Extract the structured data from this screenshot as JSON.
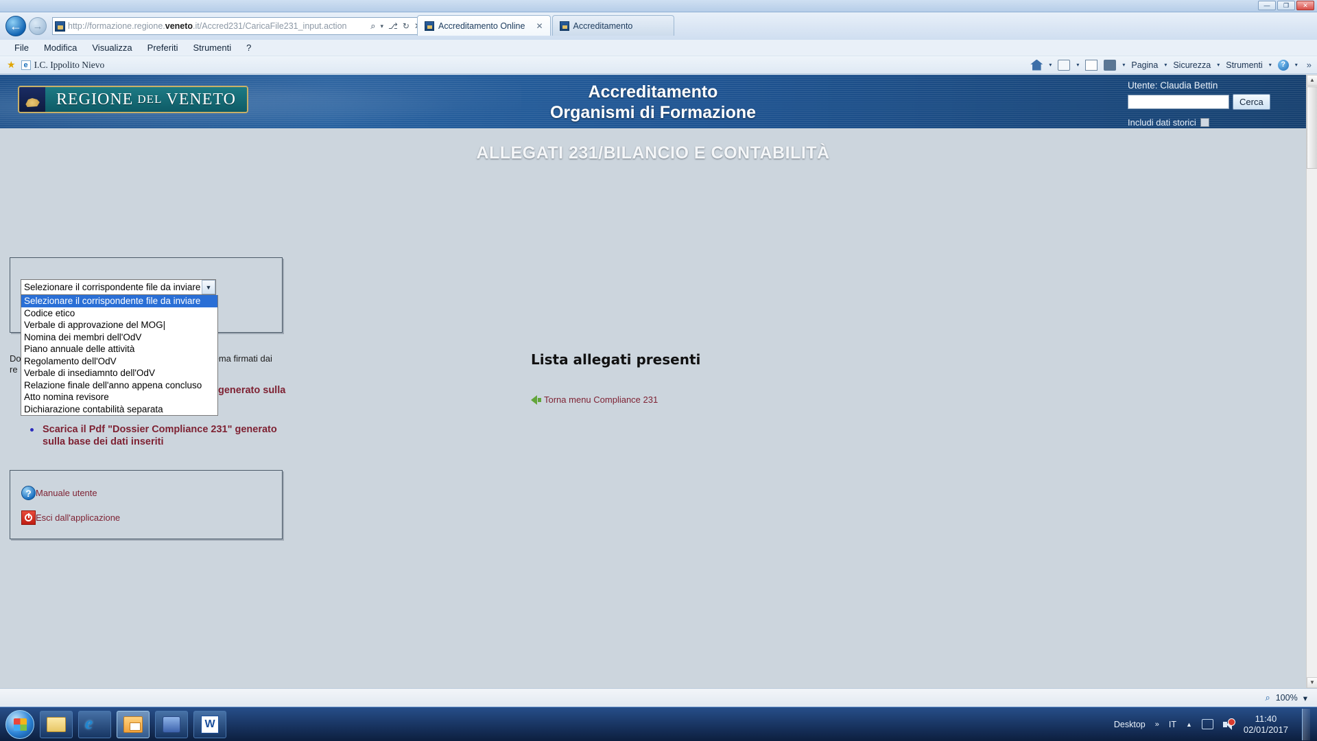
{
  "browser": {
    "address_url_prefix": "http://formazione.regione.",
    "address_url_bold": "veneto",
    "address_url_suffix": ".it/Accred231/CaricaFile231_input.action",
    "tabs": [
      {
        "label": "Accreditamento Online",
        "active": true,
        "close": "✕"
      },
      {
        "label": "Accreditamento",
        "active": false,
        "close": ""
      }
    ],
    "menu": [
      "File",
      "Modifica",
      "Visualizza",
      "Preferiti",
      "Strumenti",
      "?"
    ],
    "favorites": {
      "item": "I.C. Ippolito Nievo"
    },
    "command_bar": [
      "Pagina",
      "Sicurezza",
      "Strumenti"
    ],
    "command_overflow": "»",
    "window_buttons": {
      "minimize": "—",
      "maximize": "❐",
      "close": "✕"
    },
    "nav_back": "←",
    "nav_forward": "→",
    "addr_icons": {
      "search": "⌕",
      "compat": "⎇",
      "refresh": "↻",
      "stop": "✕",
      "caret": "▾"
    }
  },
  "banner": {
    "logo_first": "REGIONE",
    "logo_small": "DEL",
    "logo_last": "VENETO",
    "title_line1": "Accreditamento",
    "title_line2": "Organismi di Formazione",
    "user_label": "Utente: Claudia Bettin",
    "search_value": "",
    "search_placeholder": "",
    "search_button": "Cerca",
    "history_label": "Includi dati storici"
  },
  "page": {
    "title": "ALLEGATI 231/BILANCIO E CONTABILITÀ"
  },
  "upload_panel": {
    "select_value": "Selezionare il corrispondente file da inviare",
    "options": [
      "Selezionare il corrispondente file da inviare",
      "Codice etico",
      "Verbale di approvazione del MOG|",
      "Nomina dei membri dell'OdV",
      "Piano annuale delle attività",
      "Regolamento dell'OdV",
      "Verbale di insediamnto dell'OdV",
      "Relazione finale dell'anno appena concluso",
      "Atto nomina revisore",
      "Dichiarazione contabilità separata"
    ],
    "selected_index": 0,
    "dropdown_arrow": "▼"
  },
  "notes": {
    "frag_left_line1": "Do",
    "frag_left_line2": "re",
    "frag_right_line1": "tema firmati dai",
    "bullet_items": [
      "Scarica il Pdf \"Dossier Compliance 231\" generato sulla base dei dati inseriti"
    ],
    "frag_generato": "generato sulla"
  },
  "links_panel": {
    "manual_label": "Manuale utente",
    "manual_icon": "?",
    "exit_label": "Esci dall'applicazione"
  },
  "main": {
    "list_title": "Lista allegati presenti",
    "back_link": "Torna menu Compliance 231"
  },
  "status": {
    "zoom": "100%",
    "zoom_icon": "⌕",
    "caret": "▾"
  },
  "taskbar": {
    "buttons": [
      "explorer",
      "internet-explorer",
      "outlook",
      "messenger",
      "word"
    ],
    "desktop_label": "Desktop",
    "overflow": "»",
    "language": "IT",
    "time": "11:40",
    "date": "02/01/2017",
    "tray_caret": "▲"
  }
}
